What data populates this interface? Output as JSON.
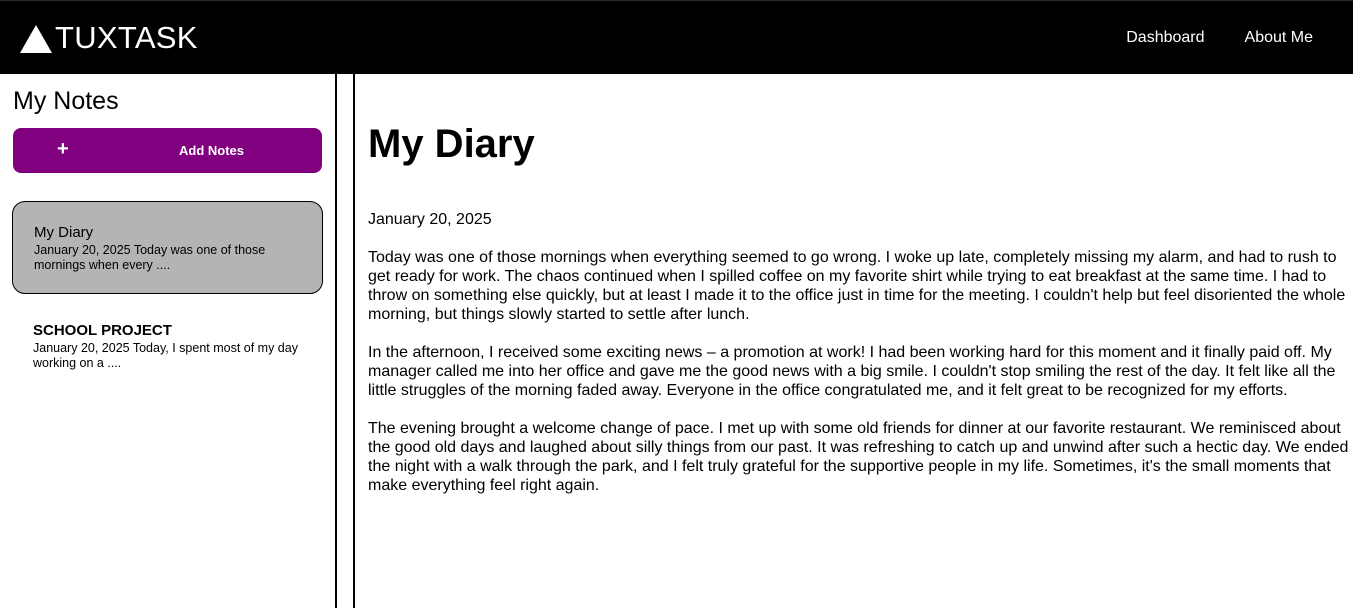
{
  "header": {
    "brand": "TUXTASK",
    "nav": [
      {
        "label": "Dashboard"
      },
      {
        "label": "About Me"
      }
    ]
  },
  "sidebar": {
    "title": "My Notes",
    "add_button": {
      "icon": "+",
      "label": "Add Notes"
    },
    "notes": [
      {
        "title": "My Diary",
        "snippet": "January 20, 2025 Today was one of those mornings when every ....",
        "active": true
      },
      {
        "title": "SCHOOL PROJECT",
        "snippet": "January 20, 2025 Today, I spent most of my day working on a ....",
        "active": false
      }
    ]
  },
  "document": {
    "title": "My Diary",
    "date": "January 20, 2025",
    "paragraphs": [
      "Today was one of those mornings when everything seemed to go wrong. I woke up late, completely missing my alarm, and had to rush to get ready for work. The chaos continued when I spilled coffee on my favorite shirt while trying to eat breakfast at the same time. I had to throw on something else quickly, but at least I made it to the office just in time for the meeting. I couldn't help but feel disoriented the whole morning, but things slowly started to settle after lunch.",
      "In the afternoon, I received some exciting news – a promotion at work! I had been working hard for this moment and it finally paid off. My manager called me into her office and gave me the good news with a big smile. I couldn't stop smiling the rest of the day. It felt like all the little struggles of the morning faded away. Everyone in the office congratulated me, and it felt great to be recognized for my efforts.",
      "The evening brought a welcome change of pace. I met up with some old friends for dinner at our favorite restaurant. We reminisced about the good old days and laughed about silly things from our past. It was refreshing to catch up and unwind after such a hectic day. We ended the night with a walk through the park, and I felt truly grateful for the supportive people in my life. Sometimes, it's the small moments that make everything feel right again."
    ]
  },
  "colors": {
    "header_bg": "#000000",
    "accent_purple": "#800080",
    "active_note_bg": "#b5b3b3"
  },
  "icons": {
    "brand_logo": "triangle-logo-icon",
    "add": "plus-icon"
  }
}
